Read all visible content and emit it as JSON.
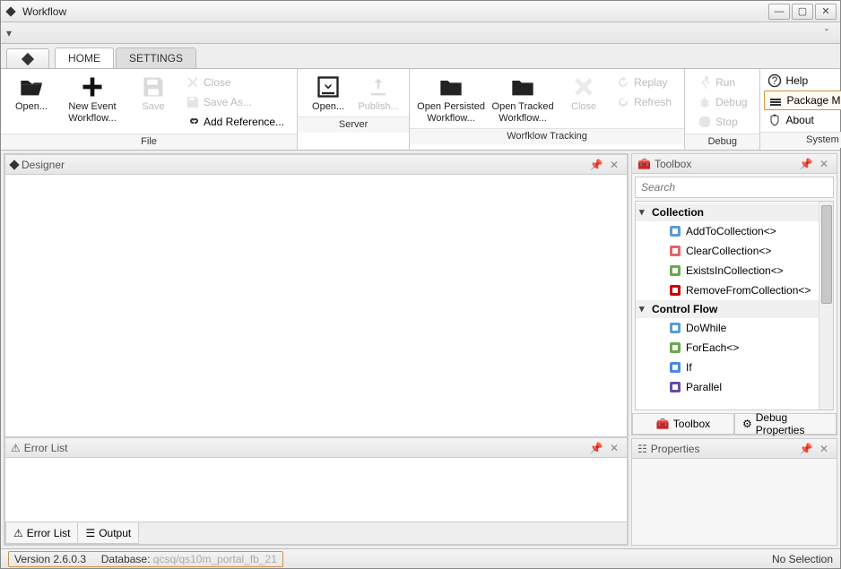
{
  "window": {
    "title": "Workflow"
  },
  "tabs": {
    "pre_icon": "diamond-icon",
    "home": "HOME",
    "settings": "SETTINGS"
  },
  "ribbon": {
    "file": {
      "caption": "File",
      "open": "Open...",
      "new_event": "New Event\nWorkflow...",
      "save": "Save",
      "close": "Close",
      "save_as": "Save As...",
      "add_reference": "Add Reference..."
    },
    "server": {
      "caption": "Server",
      "open": "Open...",
      "publish": "Publish..."
    },
    "tracking": {
      "caption": "Worfklow Tracking",
      "open_persisted": "Open Persisted\nWorkflow...",
      "open_tracked": "Open Tracked\nWorkflow...",
      "close": "Close",
      "replay": "Replay",
      "refresh": "Refresh"
    },
    "debug": {
      "caption": "Debug",
      "run": "Run",
      "debug": "Debug",
      "stop": "Stop"
    },
    "system": {
      "caption": "System",
      "help": "Help",
      "package_manager": "Package Manager",
      "about": "About"
    }
  },
  "panels": {
    "designer": "Designer",
    "error_list": "Error List",
    "output": "Output",
    "toolbox": "Toolbox",
    "debug_properties": "Debug Properties",
    "properties": "Properties",
    "search_placeholder": "Search"
  },
  "toolbox_tree": {
    "categories": [
      {
        "name": "Collection",
        "items": [
          "AddToCollection<>",
          "ClearCollection<>",
          "ExistsInCollection<>",
          "RemoveFromCollection<>"
        ]
      },
      {
        "name": "Control Flow",
        "items": [
          "DoWhile",
          "ForEach<>",
          "If",
          "Parallel"
        ]
      }
    ]
  },
  "status": {
    "version_label": "Version 2.6.0.3",
    "database_label": "Database:",
    "database_value": "qcsq/qs10m_portal_fb_21",
    "no_selection": "No Selection"
  }
}
